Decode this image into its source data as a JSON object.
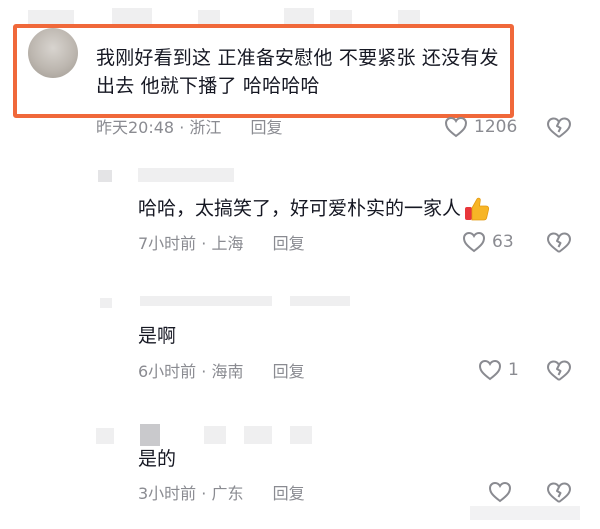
{
  "comments": [
    {
      "text": "我刚好看到这 正准备安慰他 不要紧张 还没有发出去 他就下播了 哈哈哈哈",
      "time": "昨天20:48",
      "location": "浙江",
      "reply_label": "回复",
      "likes": "1206"
    },
    {
      "text": "哈哈，太搞笑了，好可爱朴实的一家人",
      "time": "7小时前",
      "location": "上海",
      "reply_label": "回复",
      "likes": "63"
    },
    {
      "text": "是啊",
      "time": "6小时前",
      "location": "海南",
      "reply_label": "回复",
      "likes": "1"
    },
    {
      "text": "是的",
      "time": "3小时前",
      "location": "广东",
      "reply_label": "回复",
      "likes": ""
    }
  ],
  "icons": {
    "like": "heart-outline-icon",
    "dislike": "broken-heart-icon",
    "emoji": "thumbs-up-emoji"
  },
  "colors": {
    "highlight_border": "#f0683a",
    "meta_text": "#8a8b91",
    "body_text": "#161823"
  },
  "separator": "·"
}
